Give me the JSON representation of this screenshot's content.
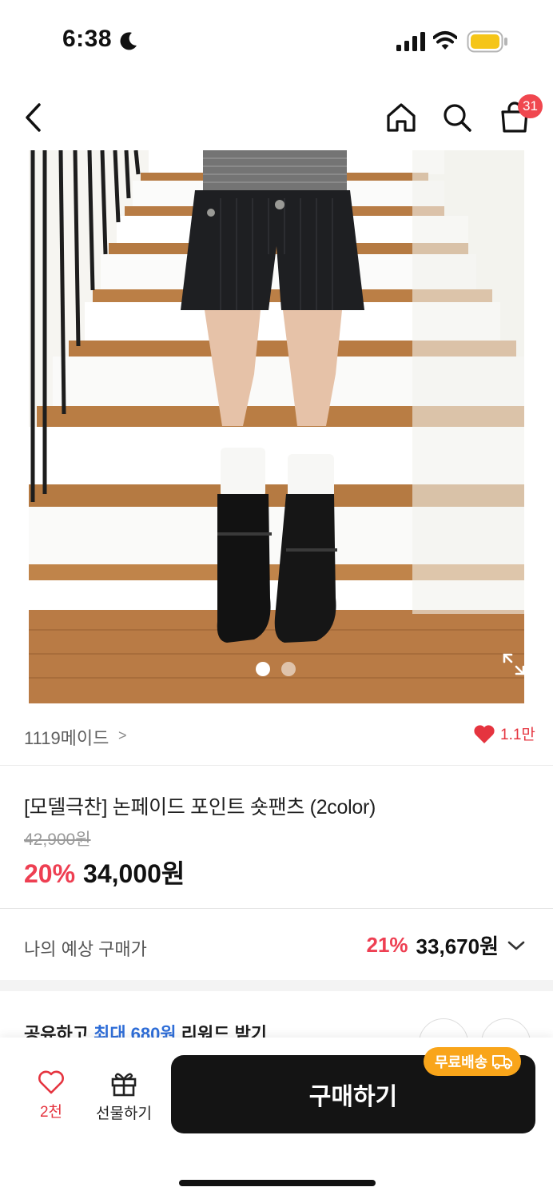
{
  "status_bar": {
    "time": "6:38",
    "icons": [
      "moon-icon",
      "signal-icon",
      "wifi-icon",
      "battery-icon"
    ],
    "battery_color": "#f5c518"
  },
  "nav": {
    "icons": [
      "back-icon",
      "home-icon",
      "search-icon",
      "cart-icon"
    ],
    "cart_badge": "31"
  },
  "product": {
    "image_icon": "expand-icon",
    "brand": "1119메이드",
    "brand_chevron": ">",
    "likes": "1.1만",
    "title": "[모델극찬] 논페이드 포인트 숏팬츠 (2color)",
    "original_price": "42,900원",
    "discount_rate": "20%",
    "sale_price": "34,000원"
  },
  "expected_price": {
    "label": "나의 예상 구매가",
    "rate": "21%",
    "price": "33,670원"
  },
  "reward": {
    "prefix": "공유하고 ",
    "highlight": "최대 680원",
    "suffix": " 리워드 받기"
  },
  "bottom_bar": {
    "wish_count": "2천",
    "gift_label": "선물하기",
    "buy_label": "구매하기",
    "free_shipping": "무료배송"
  },
  "colors": {
    "accent_red": "#ee3f52",
    "link_blue": "#2f6ed8",
    "badge_orange": "#f9a51a",
    "buy_button": "#141414"
  }
}
